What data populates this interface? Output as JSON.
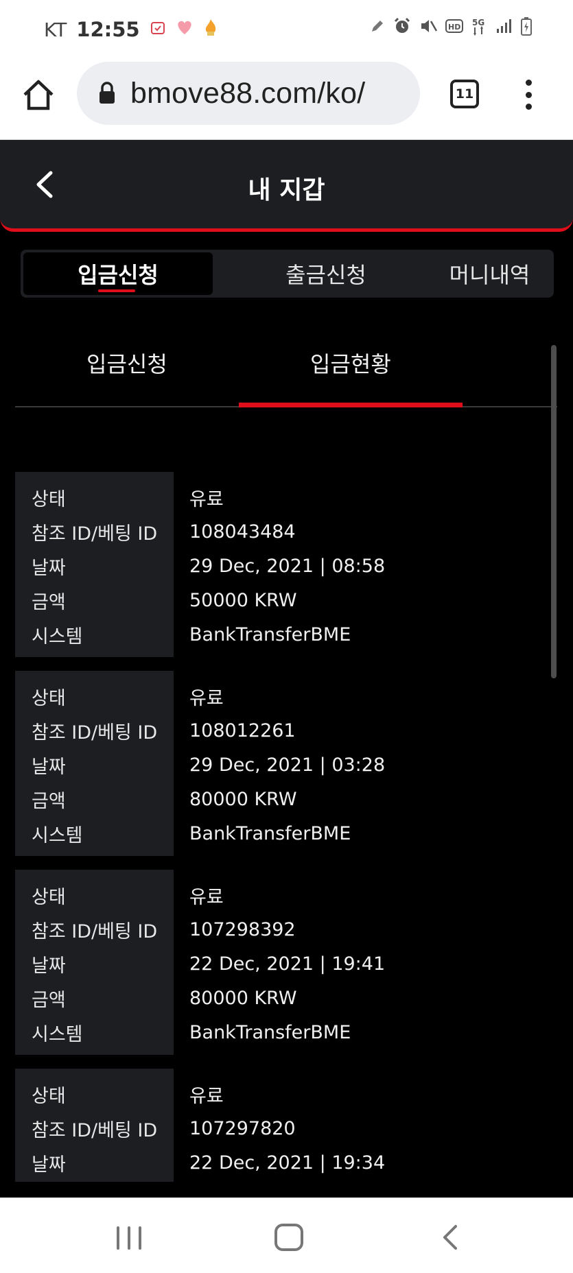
{
  "status_bar": {
    "carrier": "KT",
    "time": "12:55"
  },
  "browser": {
    "url": "bmove88.com/ko/",
    "tab_count": "11"
  },
  "wallet": {
    "title": "내 지갑"
  },
  "top_tabs": [
    {
      "label": "입금신청",
      "active": true
    },
    {
      "label": "출금신청",
      "active": false
    },
    {
      "label": "머니내역",
      "active": false
    }
  ],
  "sub_tabs": [
    {
      "label": "입금신청",
      "active": false
    },
    {
      "label": "입금현황",
      "active": true
    }
  ],
  "labels": {
    "status": "상태",
    "ref_id": "참조 ID/베팅 ID",
    "date": "날짜",
    "amount": "금액",
    "system": "시스템"
  },
  "records": [
    {
      "status": "유료",
      "ref_id": "108043484",
      "date": "29 Dec, 2021 | 08:58",
      "amount": "50000 KRW",
      "system": "BankTransferBME"
    },
    {
      "status": "유료",
      "ref_id": "108012261",
      "date": "29 Dec, 2021 | 03:28",
      "amount": "80000 KRW",
      "system": "BankTransferBME"
    },
    {
      "status": "유료",
      "ref_id": "107298392",
      "date": "22 Dec, 2021 | 19:41",
      "amount": "80000 KRW",
      "system": "BankTransferBME"
    },
    {
      "status": "유료",
      "ref_id": "107297820",
      "date": "22 Dec, 2021 | 19:34",
      "amount": "",
      "system": ""
    }
  ],
  "colors": {
    "accent": "#e00d1a",
    "panel": "#1c1e22",
    "background": "#000000"
  }
}
